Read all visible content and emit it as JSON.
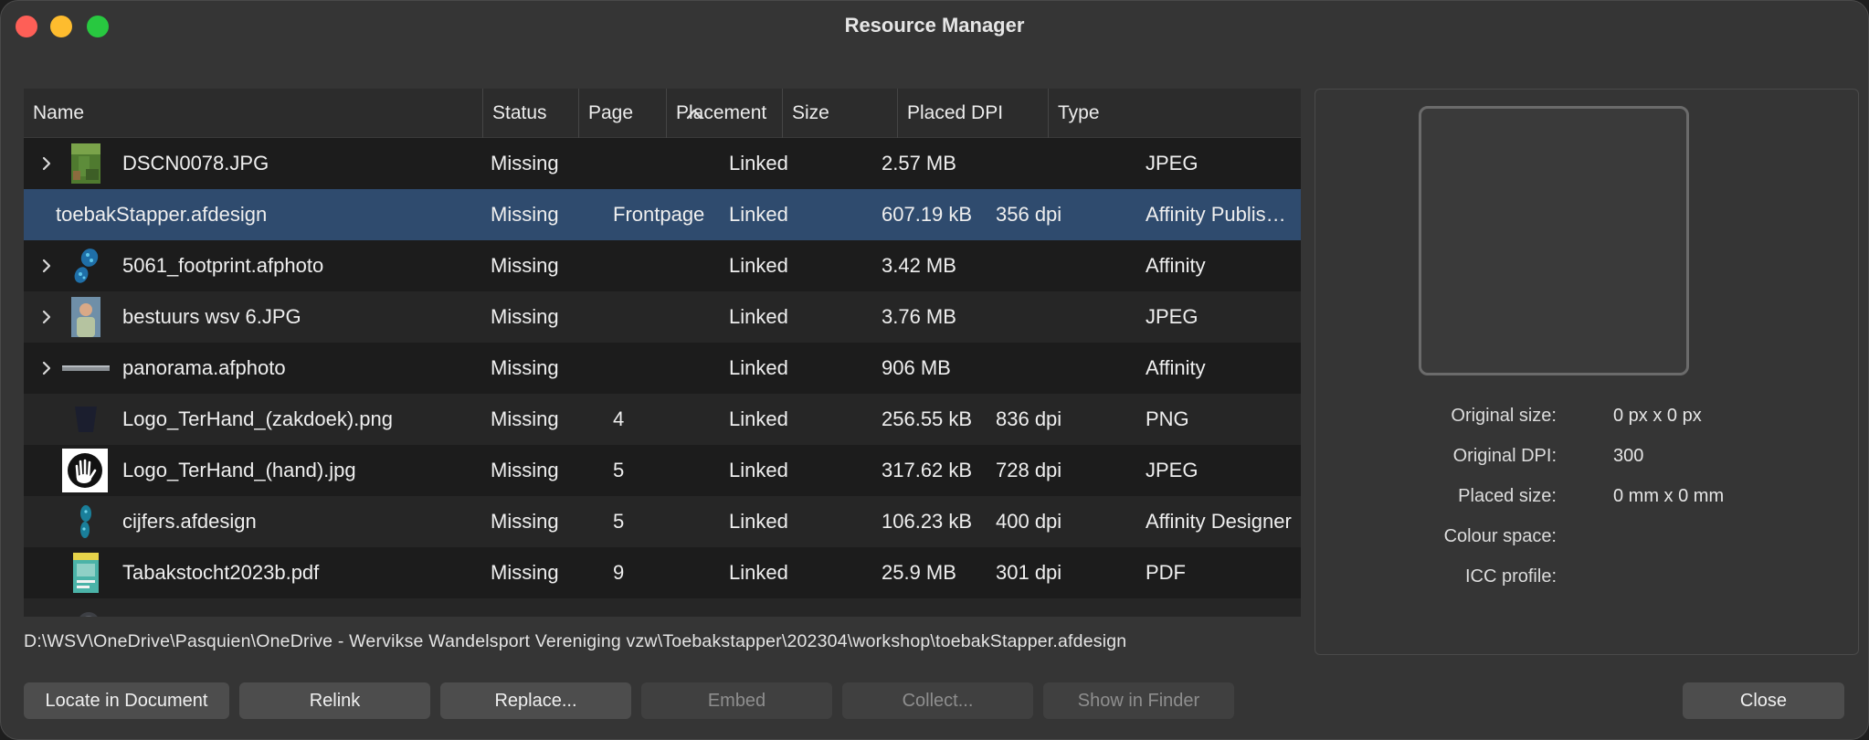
{
  "window": {
    "title": "Resource Manager"
  },
  "table": {
    "columns": {
      "name": "Name",
      "status": "Status",
      "page": "Page",
      "placement": "Placement",
      "size": "Size",
      "dpi": "Placed DPI",
      "type": "Type"
    },
    "rows": [
      {
        "name": "DSCN0078.JPG",
        "status": "Missing",
        "page": "",
        "placement": "Linked",
        "size": "2.57 MB",
        "dpi": "",
        "type": "JPEG"
      },
      {
        "name": "toebakStapper.afdesign",
        "status": "Missing",
        "page": "Frontpage",
        "placement": "Linked",
        "size": "607.19 kB",
        "dpi": "356 dpi",
        "type": "Affinity Publis…"
      },
      {
        "name": "5061_footprint.afphoto",
        "status": "Missing",
        "page": "",
        "placement": "Linked",
        "size": "3.42 MB",
        "dpi": "",
        "type": "Affinity"
      },
      {
        "name": "bestuurs wsv 6.JPG",
        "status": "Missing",
        "page": "",
        "placement": "Linked",
        "size": "3.76 MB",
        "dpi": "",
        "type": "JPEG"
      },
      {
        "name": "panorama.afphoto",
        "status": "Missing",
        "page": "",
        "placement": "Linked",
        "size": "906 MB",
        "dpi": "",
        "type": "Affinity"
      },
      {
        "name": "Logo_TerHand_(zakdoek).png",
        "status": "Missing",
        "page": "4",
        "placement": "Linked",
        "size": "256.55 kB",
        "dpi": "836 dpi",
        "type": "PNG"
      },
      {
        "name": "Logo_TerHand_(hand).jpg",
        "status": "Missing",
        "page": "5",
        "placement": "Linked",
        "size": "317.62 kB",
        "dpi": "728 dpi",
        "type": "JPEG"
      },
      {
        "name": "cijfers.afdesign",
        "status": "Missing",
        "page": "5",
        "placement": "Linked",
        "size": "106.23 kB",
        "dpi": "400 dpi",
        "type": "Affinity Designer"
      },
      {
        "name": "Tabakstocht2023b.pdf",
        "status": "Missing",
        "page": "9",
        "placement": "Linked",
        "size": "25.9 MB",
        "dpi": "301 dpi",
        "type": "PDF"
      }
    ]
  },
  "path": "D:\\WSV\\OneDrive\\Pasquien\\OneDrive - Wervikse Wandelsport Vereniging vzw\\Toebakstapper\\202304\\workshop\\toebakStapper.afdesign",
  "info": {
    "original_size_label": "Original size:",
    "original_size_value": "0 px x 0 px",
    "original_dpi_label": "Original DPI:",
    "original_dpi_value": "300",
    "placed_size_label": "Placed size:",
    "placed_size_value": "0 mm x 0 mm",
    "colour_space_label": "Colour space:",
    "icc_profile_label": "ICC profile:"
  },
  "buttons": {
    "locate": "Locate in Document",
    "relink": "Relink",
    "replace": "Replace...",
    "embed": "Embed",
    "collect": "Collect...",
    "show_in_finder": "Show in Finder",
    "close": "Close"
  },
  "colors": {
    "selection": "#2f4b6e",
    "window_bg": "#353535",
    "table_bg": "#1c1c1c"
  }
}
